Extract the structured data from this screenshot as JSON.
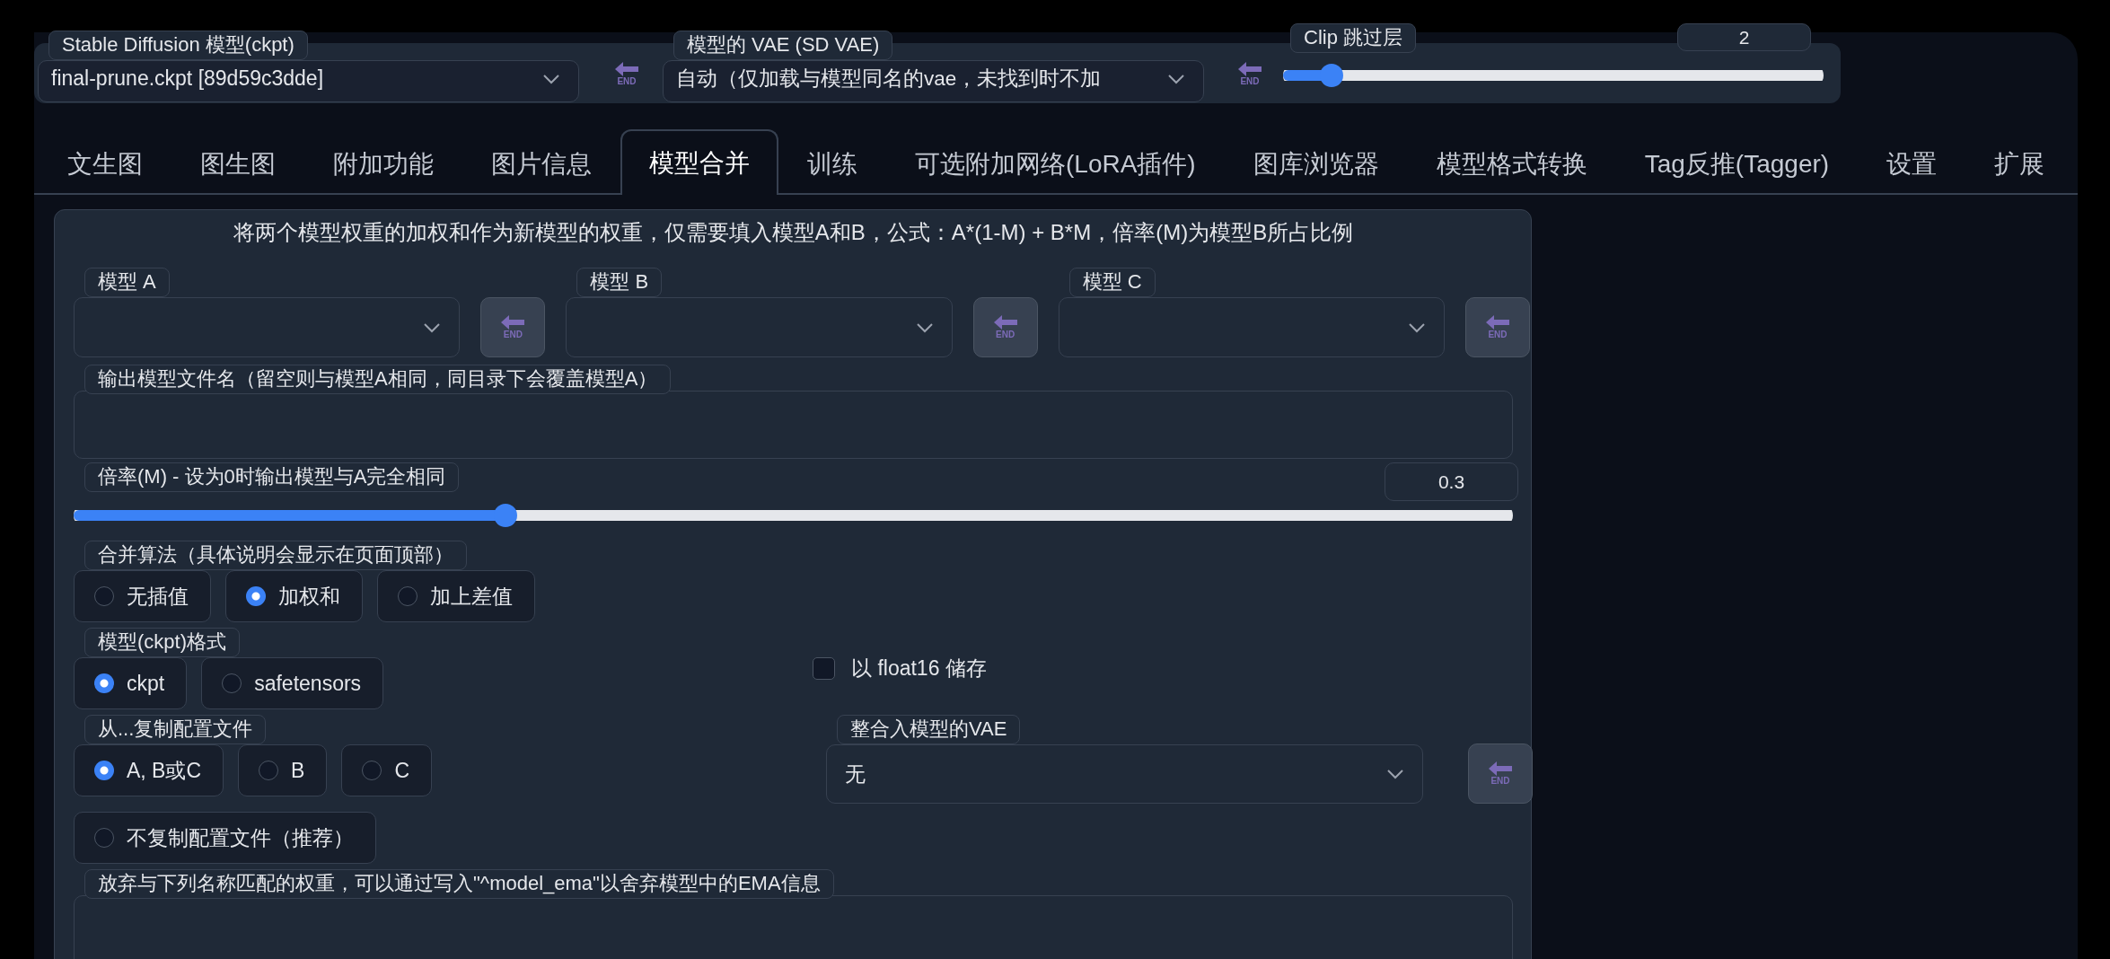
{
  "top_bar": {
    "checkpoint": {
      "label": "Stable Diffusion 模型(ckpt)",
      "value": "final-prune.ckpt [89d59c3dde]",
      "end_button": "END"
    },
    "vae": {
      "label": "模型的 VAE (SD VAE)",
      "value": "自动（仅加载与模型同名的vae，未找到时不加",
      "end_button": "END"
    },
    "clip_skip": {
      "label": "Clip 跳过层",
      "value": "2",
      "level": 0.09
    }
  },
  "tabs": [
    {
      "label": "文生图",
      "selected": false
    },
    {
      "label": "图生图",
      "selected": false
    },
    {
      "label": "附加功能",
      "selected": false
    },
    {
      "label": "图片信息",
      "selected": false
    },
    {
      "label": "模型合并",
      "selected": true
    },
    {
      "label": "训练",
      "selected": false
    },
    {
      "label": "可选附加网络(LoRA插件)",
      "selected": false
    },
    {
      "label": "图库浏览器",
      "selected": false
    },
    {
      "label": "模型格式转换",
      "selected": false
    },
    {
      "label": "Tag反推(Tagger)",
      "selected": false
    },
    {
      "label": "设置",
      "selected": false
    },
    {
      "label": "扩展",
      "selected": false
    }
  ],
  "merge_panel": {
    "description": "将两个模型权重的加权和作为新模型的权重，仅需要填入模型A和B，公式：A*(1-M) + B*M，倍率(M)为模型B所占比例",
    "models": [
      {
        "label": "模型 A",
        "end_button": "END"
      },
      {
        "label": "模型 B",
        "end_button": "END"
      },
      {
        "label": "模型 C",
        "end_button": "END"
      }
    ],
    "output_name": {
      "label": "输出模型文件名（留空则与模型A相同，同目录下会覆盖模型A）"
    },
    "multiplier": {
      "label": "倍率(M) - 设为0时输出模型与A完全相同",
      "value": "0.3",
      "level": 0.3
    },
    "interpolation": {
      "label": "合并算法（具体说明会显示在页面顶部）",
      "options": [
        {
          "label": "无插值",
          "selected": false
        },
        {
          "label": "加权和",
          "selected": true
        },
        {
          "label": "加上差值",
          "selected": false
        }
      ]
    },
    "format": {
      "label": "模型(ckpt)格式",
      "options": [
        {
          "label": "ckpt",
          "selected": true
        },
        {
          "label": "safetensors",
          "selected": false
        }
      ]
    },
    "save_float16": {
      "label": "以 float16 储存",
      "checked": false
    },
    "config_source": {
      "label": "从...复制配置文件",
      "options": [
        {
          "label": "A, B或C",
          "selected": true
        },
        {
          "label": "B",
          "selected": false
        },
        {
          "label": "C",
          "selected": false
        },
        {
          "label": "不复制配置文件（推荐）",
          "selected": false
        }
      ]
    },
    "bake_vae": {
      "label": "整合入模型的VAE",
      "value": "无",
      "end_button": "END"
    },
    "discard_weights": {
      "label": "放弃与下列名称匹配的权重，可以通过写入\"^model_ema\"以舍弃模型中的EMA信息"
    }
  }
}
